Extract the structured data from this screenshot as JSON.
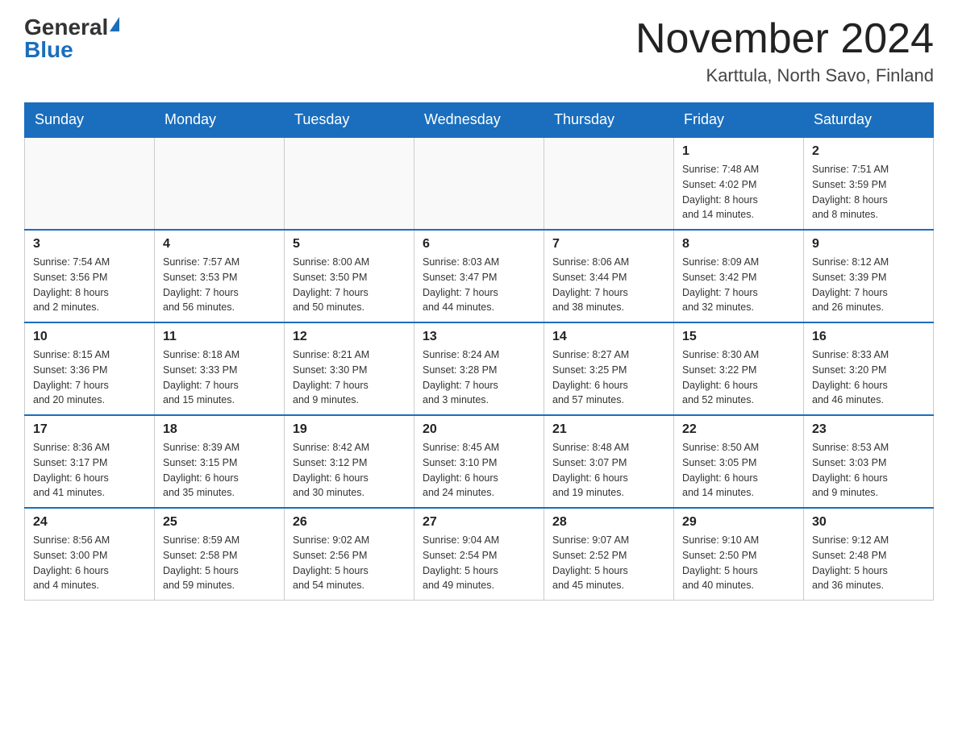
{
  "header": {
    "logo_general": "General",
    "logo_blue": "Blue",
    "title": "November 2024",
    "subtitle": "Karttula, North Savo, Finland"
  },
  "days_of_week": [
    "Sunday",
    "Monday",
    "Tuesday",
    "Wednesday",
    "Thursday",
    "Friday",
    "Saturday"
  ],
  "weeks": [
    [
      {
        "day": "",
        "info": ""
      },
      {
        "day": "",
        "info": ""
      },
      {
        "day": "",
        "info": ""
      },
      {
        "day": "",
        "info": ""
      },
      {
        "day": "",
        "info": ""
      },
      {
        "day": "1",
        "info": "Sunrise: 7:48 AM\nSunset: 4:02 PM\nDaylight: 8 hours\nand 14 minutes."
      },
      {
        "day": "2",
        "info": "Sunrise: 7:51 AM\nSunset: 3:59 PM\nDaylight: 8 hours\nand 8 minutes."
      }
    ],
    [
      {
        "day": "3",
        "info": "Sunrise: 7:54 AM\nSunset: 3:56 PM\nDaylight: 8 hours\nand 2 minutes."
      },
      {
        "day": "4",
        "info": "Sunrise: 7:57 AM\nSunset: 3:53 PM\nDaylight: 7 hours\nand 56 minutes."
      },
      {
        "day": "5",
        "info": "Sunrise: 8:00 AM\nSunset: 3:50 PM\nDaylight: 7 hours\nand 50 minutes."
      },
      {
        "day": "6",
        "info": "Sunrise: 8:03 AM\nSunset: 3:47 PM\nDaylight: 7 hours\nand 44 minutes."
      },
      {
        "day": "7",
        "info": "Sunrise: 8:06 AM\nSunset: 3:44 PM\nDaylight: 7 hours\nand 38 minutes."
      },
      {
        "day": "8",
        "info": "Sunrise: 8:09 AM\nSunset: 3:42 PM\nDaylight: 7 hours\nand 32 minutes."
      },
      {
        "day": "9",
        "info": "Sunrise: 8:12 AM\nSunset: 3:39 PM\nDaylight: 7 hours\nand 26 minutes."
      }
    ],
    [
      {
        "day": "10",
        "info": "Sunrise: 8:15 AM\nSunset: 3:36 PM\nDaylight: 7 hours\nand 20 minutes."
      },
      {
        "day": "11",
        "info": "Sunrise: 8:18 AM\nSunset: 3:33 PM\nDaylight: 7 hours\nand 15 minutes."
      },
      {
        "day": "12",
        "info": "Sunrise: 8:21 AM\nSunset: 3:30 PM\nDaylight: 7 hours\nand 9 minutes."
      },
      {
        "day": "13",
        "info": "Sunrise: 8:24 AM\nSunset: 3:28 PM\nDaylight: 7 hours\nand 3 minutes."
      },
      {
        "day": "14",
        "info": "Sunrise: 8:27 AM\nSunset: 3:25 PM\nDaylight: 6 hours\nand 57 minutes."
      },
      {
        "day": "15",
        "info": "Sunrise: 8:30 AM\nSunset: 3:22 PM\nDaylight: 6 hours\nand 52 minutes."
      },
      {
        "day": "16",
        "info": "Sunrise: 8:33 AM\nSunset: 3:20 PM\nDaylight: 6 hours\nand 46 minutes."
      }
    ],
    [
      {
        "day": "17",
        "info": "Sunrise: 8:36 AM\nSunset: 3:17 PM\nDaylight: 6 hours\nand 41 minutes."
      },
      {
        "day": "18",
        "info": "Sunrise: 8:39 AM\nSunset: 3:15 PM\nDaylight: 6 hours\nand 35 minutes."
      },
      {
        "day": "19",
        "info": "Sunrise: 8:42 AM\nSunset: 3:12 PM\nDaylight: 6 hours\nand 30 minutes."
      },
      {
        "day": "20",
        "info": "Sunrise: 8:45 AM\nSunset: 3:10 PM\nDaylight: 6 hours\nand 24 minutes."
      },
      {
        "day": "21",
        "info": "Sunrise: 8:48 AM\nSunset: 3:07 PM\nDaylight: 6 hours\nand 19 minutes."
      },
      {
        "day": "22",
        "info": "Sunrise: 8:50 AM\nSunset: 3:05 PM\nDaylight: 6 hours\nand 14 minutes."
      },
      {
        "day": "23",
        "info": "Sunrise: 8:53 AM\nSunset: 3:03 PM\nDaylight: 6 hours\nand 9 minutes."
      }
    ],
    [
      {
        "day": "24",
        "info": "Sunrise: 8:56 AM\nSunset: 3:00 PM\nDaylight: 6 hours\nand 4 minutes."
      },
      {
        "day": "25",
        "info": "Sunrise: 8:59 AM\nSunset: 2:58 PM\nDaylight: 5 hours\nand 59 minutes."
      },
      {
        "day": "26",
        "info": "Sunrise: 9:02 AM\nSunset: 2:56 PM\nDaylight: 5 hours\nand 54 minutes."
      },
      {
        "day": "27",
        "info": "Sunrise: 9:04 AM\nSunset: 2:54 PM\nDaylight: 5 hours\nand 49 minutes."
      },
      {
        "day": "28",
        "info": "Sunrise: 9:07 AM\nSunset: 2:52 PM\nDaylight: 5 hours\nand 45 minutes."
      },
      {
        "day": "29",
        "info": "Sunrise: 9:10 AM\nSunset: 2:50 PM\nDaylight: 5 hours\nand 40 minutes."
      },
      {
        "day": "30",
        "info": "Sunrise: 9:12 AM\nSunset: 2:48 PM\nDaylight: 5 hours\nand 36 minutes."
      }
    ]
  ]
}
